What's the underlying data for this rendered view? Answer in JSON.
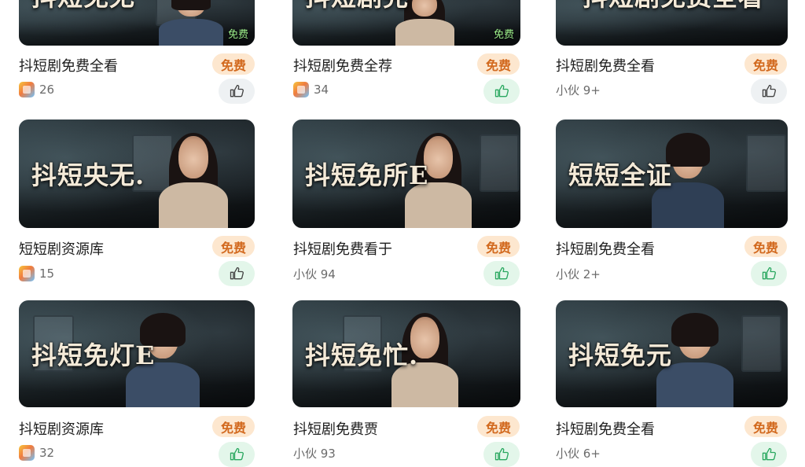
{
  "cards": [
    {
      "overlay": "抖短免无",
      "title": "抖短剧免费全看",
      "price": "免费",
      "stat": "26",
      "stat_icon": "app-icon",
      "like_on": false,
      "free_tag": "免费"
    },
    {
      "overlay": "抖短剧完",
      "title": "抖短剧免费全荐",
      "price": "免费",
      "stat": "34",
      "stat_icon": "app-icon",
      "like_on": true,
      "free_tag": "免费"
    },
    {
      "overlay": "抖短剧免费全看",
      "title": "抖短剧免费全看",
      "price": "免费",
      "stat": "小伙 9+",
      "stat_icon": "",
      "like_on": false,
      "free_tag": ""
    },
    {
      "overlay": "抖短央无.",
      "title": "短短剧资源库",
      "price": "免费",
      "stat": "15",
      "stat_icon": "app-icon",
      "like_on": false,
      "free_tag": ""
    },
    {
      "overlay": "抖短免所E",
      "title": "抖短剧免费看于",
      "price": "免费",
      "stat": "小伙 94",
      "stat_icon": "",
      "like_on": true,
      "free_tag": ""
    },
    {
      "overlay": "短短全证",
      "title": "抖短剧免费全看",
      "price": "免费",
      "stat": "小伙 2+",
      "stat_icon": "",
      "like_on": true,
      "free_tag": ""
    },
    {
      "overlay": "抖短免灯E",
      "title": "抖短剧资源库",
      "price": "免费",
      "stat": "32",
      "stat_icon": "app-icon",
      "like_on": true,
      "free_tag": ""
    },
    {
      "overlay": "抖短免忙.",
      "title": "抖短剧免费贾",
      "price": "免费",
      "stat": "小伙 93",
      "stat_icon": "",
      "like_on": true,
      "free_tag": ""
    },
    {
      "overlay": "抖短免元",
      "title": "抖短剧免费全看",
      "price": "免费",
      "stat": "小伙 6+",
      "stat_icon": "",
      "like_on": true,
      "free_tag": ""
    }
  ]
}
